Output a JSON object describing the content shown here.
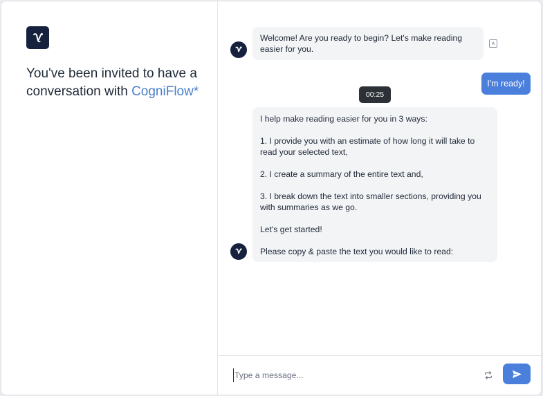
{
  "left_panel": {
    "logo_letter": "V",
    "invite_prefix": "You've been invited to have a conversation with ",
    "brand_name": "CogniFlow*"
  },
  "chat": {
    "messages": [
      {
        "sender": "bot",
        "text": "Welcome! Are you ready to begin? Let's make reading easier for you."
      },
      {
        "sender": "user",
        "text": "I'm ready!"
      },
      {
        "sender": "bot",
        "paragraphs": [
          "I help make reading easier for you in 3 ways:",
          "1. I provide you with an estimate of how long it will take to read your selected text,",
          "2. I create a summary of the entire text and,",
          "3. I break down the text into smaller sections, providing you with summaries as we go.",
          "Let's get started!",
          "Please copy & paste the text you would like to read:"
        ]
      }
    ],
    "timestamp": "00:25",
    "translate_icon_text": "A"
  },
  "composer": {
    "placeholder": "Type a message...",
    "value": ""
  },
  "colors": {
    "brand_dark": "#16213e",
    "accent": "#4a7fdc",
    "brand_text": "#4a7fc8"
  },
  "icons": {
    "logo": "v-logo-icon",
    "translate": "translate-icon",
    "repeat": "repeat-icon",
    "send": "send-icon"
  }
}
